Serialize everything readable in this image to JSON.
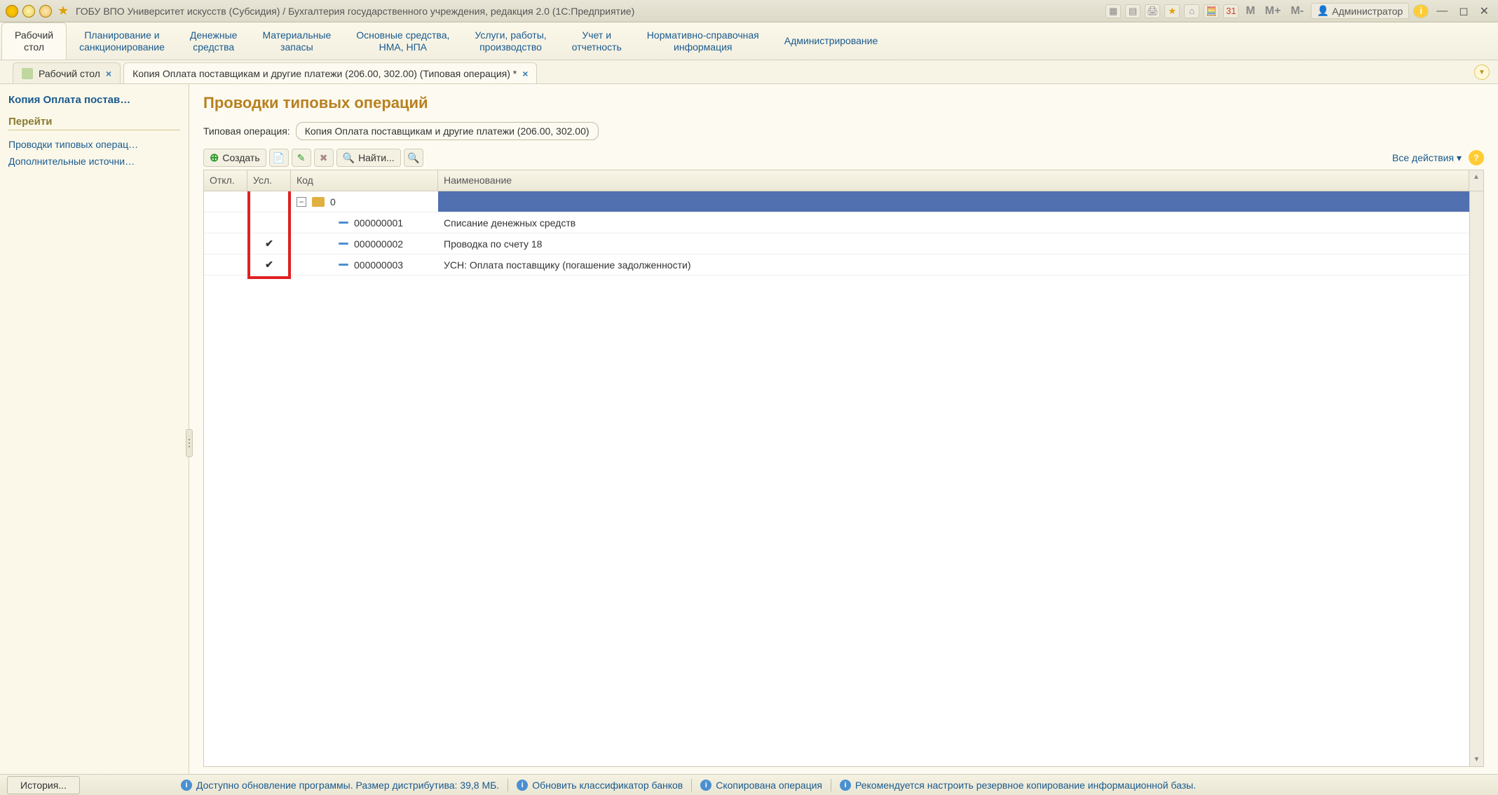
{
  "title": "ГОБУ ВПО Университет искусств (Субсидия) / Бухгалтерия государственного учреждения, редакция 2.0  (1С:Предприятие)",
  "calc": {
    "m": "M",
    "mplus": "M+",
    "mminus": "M-"
  },
  "user": "Администратор",
  "sections": [
    "Рабочий\nстол",
    "Планирование и\nсанкционирование",
    "Денежные\nсредства",
    "Материальные\nзапасы",
    "Основные средства,\nНМА, НПА",
    "Услуги, работы,\nпроизводство",
    "Учет и\nотчетность",
    "Нормативно-справочная\nинформация",
    "Администрирование"
  ],
  "tabs": {
    "t1": "Рабочий стол",
    "t2": "Копия Оплата поставщикам и другие платежи (206.00, 302.00) (Типовая операция) *"
  },
  "left": {
    "title": "Копия Оплата постав…",
    "navhead": "Перейти",
    "link1": "Проводки типовых операц…",
    "link2": "Дополнительные источни…"
  },
  "page": {
    "heading": "Проводки типовых операций",
    "field_label": "Типовая операция:",
    "field_value": "Копия Оплата поставщикам и другие платежи (206.00, 302.00)"
  },
  "toolbar": {
    "create": "Создать",
    "find": "Найти...",
    "all_actions": "Все действия ▾"
  },
  "columns": {
    "otk": "Откл.",
    "usl": "Усл.",
    "kod": "Код",
    "name": "Наименование"
  },
  "rows": [
    {
      "usl": "",
      "code": "0",
      "name": "",
      "root": true
    },
    {
      "usl": "",
      "code": "000000001",
      "name": "Списание денежных средств",
      "root": false
    },
    {
      "usl": "✔",
      "code": "000000002",
      "name": "Проводка по счету 18",
      "root": false
    },
    {
      "usl": "✔",
      "code": "000000003",
      "name": "УСН: Оплата поставщику (погашение задолженности)",
      "root": false
    }
  ],
  "status": {
    "history": "История...",
    "s1": "Доступно обновление программы. Размер дистрибутива: 39,8 МБ.",
    "s2": "Обновить классификатор банков",
    "s3": "Скопирована операция",
    "s4": "Рекомендуется настроить резервное копирование информационной базы."
  }
}
